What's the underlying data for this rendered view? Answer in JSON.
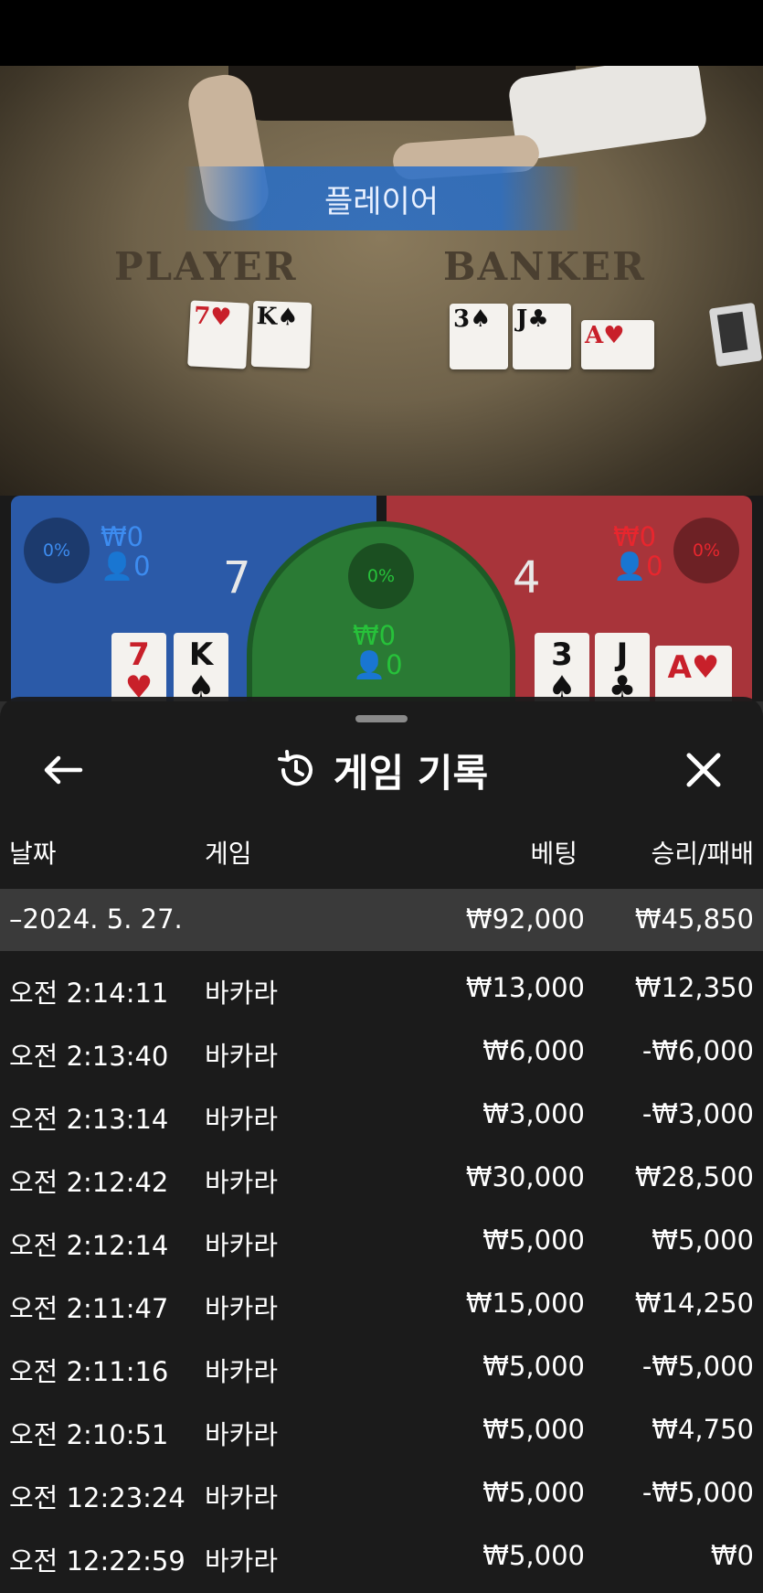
{
  "video": {
    "result_banner": "플레이어",
    "player_label": "PLAYER",
    "banker_label": "BANKER",
    "player_cards": [
      {
        "rank": "7",
        "suit": "♥",
        "color": "red"
      },
      {
        "rank": "K",
        "suit": "♠",
        "color": "black"
      }
    ],
    "banker_cards": [
      {
        "rank": "3",
        "suit": "♠",
        "color": "black"
      },
      {
        "rank": "J",
        "suit": "♣",
        "color": "black"
      },
      {
        "rank": "A",
        "suit": "♥",
        "color": "red"
      }
    ]
  },
  "betting": {
    "player": {
      "pct": "0%",
      "amount": "₩0",
      "count": "0",
      "score": "7",
      "cards": [
        {
          "rank": "7",
          "suit": "♥",
          "color": "red"
        },
        {
          "rank": "K",
          "suit": "♠",
          "color": "black"
        }
      ]
    },
    "tie": {
      "pct": "0%",
      "amount": "₩0",
      "count": "0"
    },
    "banker": {
      "pct": "0%",
      "amount": "₩0",
      "count": "0",
      "score": "4",
      "cards": [
        {
          "rank": "3",
          "suit": "♠",
          "color": "black"
        },
        {
          "rank": "J",
          "suit": "♣",
          "color": "black"
        },
        {
          "rank": "A",
          "suit": "♥",
          "color": "red"
        }
      ]
    },
    "colors": {
      "player": "#2b5aa8",
      "banker": "#a8343a",
      "tie": "#2a7a34",
      "player_text": "#3d8cf0",
      "banker_text": "#e8262e",
      "tie_text": "#27c23a"
    }
  },
  "history": {
    "title": "게임 기록",
    "icons": {
      "back": "arrow-left-icon",
      "history": "history-clock-icon",
      "close": "close-x-icon"
    },
    "columns": {
      "date": "날짜",
      "game": "게임",
      "bet": "베팅",
      "result": "승리/패배"
    },
    "day": {
      "date": "–2024. 5. 27.",
      "bet": "₩92,000",
      "result": "₩45,850"
    },
    "rows": [
      {
        "time": "오전 2:14:11",
        "game": "바카라",
        "bet": "₩13,000",
        "result": "₩12,350"
      },
      {
        "time": "오전 2:13:40",
        "game": "바카라",
        "bet": "₩6,000",
        "result": "-₩6,000"
      },
      {
        "time": "오전 2:13:14",
        "game": "바카라",
        "bet": "₩3,000",
        "result": "-₩3,000"
      },
      {
        "time": "오전 2:12:42",
        "game": "바카라",
        "bet": "₩30,000",
        "result": "₩28,500"
      },
      {
        "time": "오전 2:12:14",
        "game": "바카라",
        "bet": "₩5,000",
        "result": "₩5,000"
      },
      {
        "time": "오전 2:11:47",
        "game": "바카라",
        "bet": "₩15,000",
        "result": "₩14,250"
      },
      {
        "time": "오전 2:11:16",
        "game": "바카라",
        "bet": "₩5,000",
        "result": "-₩5,000"
      },
      {
        "time": "오전 2:10:51",
        "game": "바카라",
        "bet": "₩5,000",
        "result": "₩4,750"
      },
      {
        "time": "오전 12:23:24",
        "game": "바카라",
        "bet": "₩5,000",
        "result": "-₩5,000"
      },
      {
        "time": "오전 12:22:59",
        "game": "바카라",
        "bet": "₩5,000",
        "result": "₩0"
      }
    ]
  }
}
